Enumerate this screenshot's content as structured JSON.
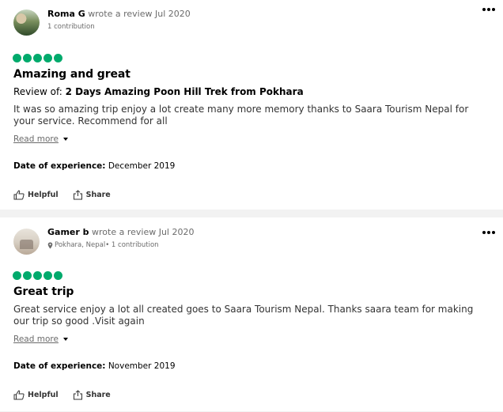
{
  "reviews": [
    {
      "username": "Roma G",
      "wrote": " wrote a review Jul 2020",
      "location": "",
      "contributions": "1 contribution",
      "rating": 5,
      "title": "Amazing and great",
      "review_of_label": "Review of: ",
      "review_of": "2 Days Amazing Poon Hill Trek from Pokhara",
      "text": "It was so amazing trip enjoy a lot create many more memory thanks to Saara Tourism Nepal for your service. Recommend for all",
      "read_more": "Read more",
      "date_label": "Date of experience:",
      "date_value": " December 2019",
      "helpful": "Helpful",
      "share": "Share"
    },
    {
      "username": "Gamer b",
      "wrote": " wrote a review Jul 2020",
      "location": "Pokhara, Nepal",
      "contributions": " • 1 contribution",
      "rating": 5,
      "title": "Great trip",
      "text": "Great service enjoy a lot all created goes to Saara Tourism Nepal. Thanks saara team for making our trip so good .Visit again",
      "read_more": "Read more",
      "date_label": "Date of experience:",
      "date_value": " November 2019",
      "helpful": "Helpful",
      "share": "Share"
    }
  ],
  "colors": {
    "rating_bubble": "#00aa6c",
    "divider": "#f2f2f2"
  },
  "icons": [
    "more-options-icon",
    "rating-bubble-icon",
    "caret-down-icon",
    "thumbs-up-icon",
    "share-icon",
    "location-pin-icon"
  ]
}
